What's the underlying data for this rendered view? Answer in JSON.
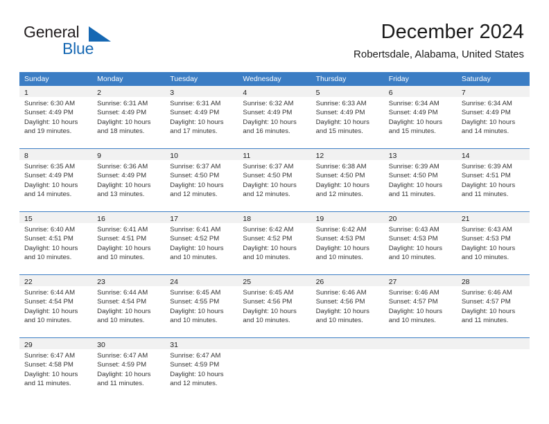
{
  "brand": {
    "name_part1": "General",
    "name_part2": "Blue",
    "accent_color": "#1668b3",
    "triangle_icon": "triangle-icon"
  },
  "header": {
    "title": "December 2024",
    "subtitle": "Robertsdale, Alabama, United States"
  },
  "calendar": {
    "header_bg": "#3b7dc4",
    "header_text_color": "#ffffff",
    "daynum_band_bg": "#f1f1f1",
    "weekdays": [
      "Sunday",
      "Monday",
      "Tuesday",
      "Wednesday",
      "Thursday",
      "Friday",
      "Saturday"
    ],
    "weeks": [
      [
        {
          "day": "1",
          "sunrise": "Sunrise: 6:30 AM",
          "sunset": "Sunset: 4:49 PM",
          "daylight1": "Daylight: 10 hours",
          "daylight2": "and 19 minutes."
        },
        {
          "day": "2",
          "sunrise": "Sunrise: 6:31 AM",
          "sunset": "Sunset: 4:49 PM",
          "daylight1": "Daylight: 10 hours",
          "daylight2": "and 18 minutes."
        },
        {
          "day": "3",
          "sunrise": "Sunrise: 6:31 AM",
          "sunset": "Sunset: 4:49 PM",
          "daylight1": "Daylight: 10 hours",
          "daylight2": "and 17 minutes."
        },
        {
          "day": "4",
          "sunrise": "Sunrise: 6:32 AM",
          "sunset": "Sunset: 4:49 PM",
          "daylight1": "Daylight: 10 hours",
          "daylight2": "and 16 minutes."
        },
        {
          "day": "5",
          "sunrise": "Sunrise: 6:33 AM",
          "sunset": "Sunset: 4:49 PM",
          "daylight1": "Daylight: 10 hours",
          "daylight2": "and 15 minutes."
        },
        {
          "day": "6",
          "sunrise": "Sunrise: 6:34 AM",
          "sunset": "Sunset: 4:49 PM",
          "daylight1": "Daylight: 10 hours",
          "daylight2": "and 15 minutes."
        },
        {
          "day": "7",
          "sunrise": "Sunrise: 6:34 AM",
          "sunset": "Sunset: 4:49 PM",
          "daylight1": "Daylight: 10 hours",
          "daylight2": "and 14 minutes."
        }
      ],
      [
        {
          "day": "8",
          "sunrise": "Sunrise: 6:35 AM",
          "sunset": "Sunset: 4:49 PM",
          "daylight1": "Daylight: 10 hours",
          "daylight2": "and 14 minutes."
        },
        {
          "day": "9",
          "sunrise": "Sunrise: 6:36 AM",
          "sunset": "Sunset: 4:49 PM",
          "daylight1": "Daylight: 10 hours",
          "daylight2": "and 13 minutes."
        },
        {
          "day": "10",
          "sunrise": "Sunrise: 6:37 AM",
          "sunset": "Sunset: 4:50 PM",
          "daylight1": "Daylight: 10 hours",
          "daylight2": "and 12 minutes."
        },
        {
          "day": "11",
          "sunrise": "Sunrise: 6:37 AM",
          "sunset": "Sunset: 4:50 PM",
          "daylight1": "Daylight: 10 hours",
          "daylight2": "and 12 minutes."
        },
        {
          "day": "12",
          "sunrise": "Sunrise: 6:38 AM",
          "sunset": "Sunset: 4:50 PM",
          "daylight1": "Daylight: 10 hours",
          "daylight2": "and 12 minutes."
        },
        {
          "day": "13",
          "sunrise": "Sunrise: 6:39 AM",
          "sunset": "Sunset: 4:50 PM",
          "daylight1": "Daylight: 10 hours",
          "daylight2": "and 11 minutes."
        },
        {
          "day": "14",
          "sunrise": "Sunrise: 6:39 AM",
          "sunset": "Sunset: 4:51 PM",
          "daylight1": "Daylight: 10 hours",
          "daylight2": "and 11 minutes."
        }
      ],
      [
        {
          "day": "15",
          "sunrise": "Sunrise: 6:40 AM",
          "sunset": "Sunset: 4:51 PM",
          "daylight1": "Daylight: 10 hours",
          "daylight2": "and 10 minutes."
        },
        {
          "day": "16",
          "sunrise": "Sunrise: 6:41 AM",
          "sunset": "Sunset: 4:51 PM",
          "daylight1": "Daylight: 10 hours",
          "daylight2": "and 10 minutes."
        },
        {
          "day": "17",
          "sunrise": "Sunrise: 6:41 AM",
          "sunset": "Sunset: 4:52 PM",
          "daylight1": "Daylight: 10 hours",
          "daylight2": "and 10 minutes."
        },
        {
          "day": "18",
          "sunrise": "Sunrise: 6:42 AM",
          "sunset": "Sunset: 4:52 PM",
          "daylight1": "Daylight: 10 hours",
          "daylight2": "and 10 minutes."
        },
        {
          "day": "19",
          "sunrise": "Sunrise: 6:42 AM",
          "sunset": "Sunset: 4:53 PM",
          "daylight1": "Daylight: 10 hours",
          "daylight2": "and 10 minutes."
        },
        {
          "day": "20",
          "sunrise": "Sunrise: 6:43 AM",
          "sunset": "Sunset: 4:53 PM",
          "daylight1": "Daylight: 10 hours",
          "daylight2": "and 10 minutes."
        },
        {
          "day": "21",
          "sunrise": "Sunrise: 6:43 AM",
          "sunset": "Sunset: 4:53 PM",
          "daylight1": "Daylight: 10 hours",
          "daylight2": "and 10 minutes."
        }
      ],
      [
        {
          "day": "22",
          "sunrise": "Sunrise: 6:44 AM",
          "sunset": "Sunset: 4:54 PM",
          "daylight1": "Daylight: 10 hours",
          "daylight2": "and 10 minutes."
        },
        {
          "day": "23",
          "sunrise": "Sunrise: 6:44 AM",
          "sunset": "Sunset: 4:54 PM",
          "daylight1": "Daylight: 10 hours",
          "daylight2": "and 10 minutes."
        },
        {
          "day": "24",
          "sunrise": "Sunrise: 6:45 AM",
          "sunset": "Sunset: 4:55 PM",
          "daylight1": "Daylight: 10 hours",
          "daylight2": "and 10 minutes."
        },
        {
          "day": "25",
          "sunrise": "Sunrise: 6:45 AM",
          "sunset": "Sunset: 4:56 PM",
          "daylight1": "Daylight: 10 hours",
          "daylight2": "and 10 minutes."
        },
        {
          "day": "26",
          "sunrise": "Sunrise: 6:46 AM",
          "sunset": "Sunset: 4:56 PM",
          "daylight1": "Daylight: 10 hours",
          "daylight2": "and 10 minutes."
        },
        {
          "day": "27",
          "sunrise": "Sunrise: 6:46 AM",
          "sunset": "Sunset: 4:57 PM",
          "daylight1": "Daylight: 10 hours",
          "daylight2": "and 10 minutes."
        },
        {
          "day": "28",
          "sunrise": "Sunrise: 6:46 AM",
          "sunset": "Sunset: 4:57 PM",
          "daylight1": "Daylight: 10 hours",
          "daylight2": "and 11 minutes."
        }
      ],
      [
        {
          "day": "29",
          "sunrise": "Sunrise: 6:47 AM",
          "sunset": "Sunset: 4:58 PM",
          "daylight1": "Daylight: 10 hours",
          "daylight2": "and 11 minutes."
        },
        {
          "day": "30",
          "sunrise": "Sunrise: 6:47 AM",
          "sunset": "Sunset: 4:59 PM",
          "daylight1": "Daylight: 10 hours",
          "daylight2": "and 11 minutes."
        },
        {
          "day": "31",
          "sunrise": "Sunrise: 6:47 AM",
          "sunset": "Sunset: 4:59 PM",
          "daylight1": "Daylight: 10 hours",
          "daylight2": "and 12 minutes."
        },
        {
          "day": "",
          "sunrise": "",
          "sunset": "",
          "daylight1": "",
          "daylight2": ""
        },
        {
          "day": "",
          "sunrise": "",
          "sunset": "",
          "daylight1": "",
          "daylight2": ""
        },
        {
          "day": "",
          "sunrise": "",
          "sunset": "",
          "daylight1": "",
          "daylight2": ""
        },
        {
          "day": "",
          "sunrise": "",
          "sunset": "",
          "daylight1": "",
          "daylight2": ""
        }
      ]
    ]
  }
}
